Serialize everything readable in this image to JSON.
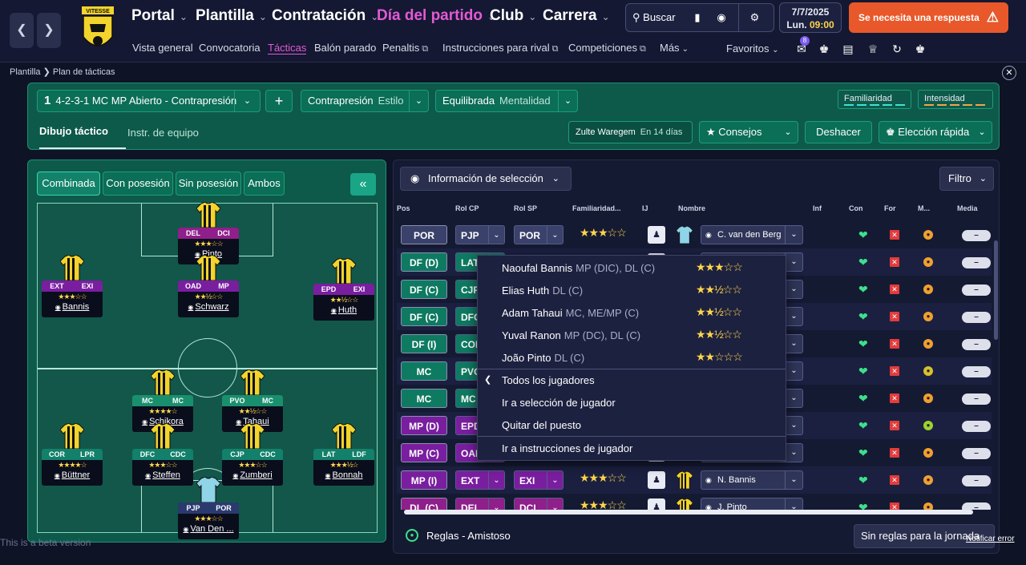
{
  "nav": {
    "items": [
      {
        "label": "Portal",
        "color": "#ffffff"
      },
      {
        "label": "Plantilla",
        "color": "#ffffff"
      },
      {
        "label": "Contratación",
        "color": "#ffffff"
      },
      {
        "label": "Día del partido",
        "color": "#e35ad4"
      },
      {
        "label": "Club",
        "color": "#ffffff"
      },
      {
        "label": "Carrera",
        "color": "#ffffff"
      }
    ],
    "sub": [
      "Vista general",
      "Convocatoria",
      "Tácticas",
      "Balón parado",
      "Penaltis",
      "Instrucciones para rival",
      "Competiciones",
      "Más"
    ],
    "active_sub": "Tácticas",
    "search_label": "Buscar",
    "date": "7/7/2025",
    "day": "Lun.",
    "time": "09:00",
    "alert": "Se necesita una respuesta",
    "favoritos": "Favoritos",
    "badge": "8",
    "crest_text": "VITESSE"
  },
  "breadcrumb": {
    "parent": "Plantilla",
    "current": "Plan de tácticas"
  },
  "tactic": {
    "number": "1",
    "name": "4-2-3-1 MC MP Abierto - Contrapresión",
    "style_value": "Contrapresión",
    "style_label": "Estilo",
    "mentality_value": "Equilibrada",
    "mentality_label": "Mentalidad",
    "familiarity": "Familiaridad",
    "intensity": "Intensidad",
    "tab_active": "Dibujo táctico",
    "tab_other": "Instr. de equipo",
    "opponent": "Zulte Waregem",
    "opponent_when": "En 14 días",
    "advice": "Consejos",
    "undo": "Deshacer",
    "quick": "Elección rápida"
  },
  "pitch_tabs": [
    "Combinada",
    "Con posesión",
    "Sin posesión",
    "Ambos"
  ],
  "players_on_pitch": [
    {
      "roles": [
        "DEL",
        "DCI"
      ],
      "stars": "★★★☆☆",
      "name": "Pinto",
      "c1": "#8f1f8a",
      "c2": "#8f1f8a"
    },
    {
      "roles": [
        "EXT",
        "EXI"
      ],
      "stars": "★★★☆☆",
      "name": "Bannis",
      "c1": "#7a1ea0",
      "c2": "#7a1ea0"
    },
    {
      "roles": [
        "OAD",
        "MP"
      ],
      "stars": "★★½☆☆",
      "name": "Schwarz",
      "c1": "#7a1ea0",
      "c2": "#7a1ea0"
    },
    {
      "roles": [
        "EPD",
        "EXI"
      ],
      "stars": "★★½☆☆",
      "name": "Huth",
      "c1": "#7a1ea0",
      "c2": "#7a1ea0"
    },
    {
      "roles": [
        "MC",
        "MC"
      ],
      "stars": "★★★★☆",
      "name": "Schikora",
      "c1": "#1a8f6e",
      "c2": "#1a8f6e"
    },
    {
      "roles": [
        "PVO",
        "MC"
      ],
      "stars": "★★½☆☆",
      "name": "Tahaui",
      "c1": "#1a8f6e",
      "c2": "#1a8f6e"
    },
    {
      "roles": [
        "COR",
        "LPR"
      ],
      "stars": "★★★★☆",
      "name": "Büttner",
      "c1": "#12806a",
      "c2": "#12806a"
    },
    {
      "roles": [
        "DFC",
        "CDC"
      ],
      "stars": "★★★☆☆",
      "name": "Steffen",
      "c1": "#12806a",
      "c2": "#12806a"
    },
    {
      "roles": [
        "CJP",
        "CDC"
      ],
      "stars": "★★★☆☆",
      "name": "Zumberi",
      "c1": "#12806a",
      "c2": "#12806a"
    },
    {
      "roles": [
        "LAT",
        "LDF"
      ],
      "stars": "★★★½☆",
      "name": "Bonnah",
      "c1": "#12806a",
      "c2": "#12806a"
    },
    {
      "roles": [
        "PJP",
        "POR"
      ],
      "stars": "★★★☆☆",
      "name": "Van Den ...",
      "c1": "#2b3a6e",
      "c2": "#2b3a6e"
    }
  ],
  "list": {
    "selector": "Información de selección",
    "filter": "Filtro",
    "headers": [
      "Pos",
      "Rol CP",
      "Rol SP",
      "Familiaridad...",
      "IJ",
      "Nombre",
      "Inf",
      "Con",
      "For",
      "M...",
      "Media"
    ],
    "rows": [
      {
        "pos": "POR",
        "rcp": "PJP",
        "rsp": "POR",
        "fam": "★★★☆☆",
        "name": "C. van den Berg",
        "color": "#3a416a",
        "mcol": "#f0a030",
        "kit": "gk"
      },
      {
        "pos": "DF (D)",
        "rcp": "LAT",
        "rsp": "",
        "fam": "",
        "name": "",
        "color": "#0e7a61",
        "mcol": "#f0a030",
        "kit": ""
      },
      {
        "pos": "DF (C)",
        "rcp": "CJP",
        "rsp": "",
        "fam": "",
        "name": "",
        "color": "#0e7a61",
        "mcol": "#f0a030",
        "kit": ""
      },
      {
        "pos": "DF (C)",
        "rcp": "DFC",
        "rsp": "",
        "fam": "",
        "name": "",
        "color": "#0e7a61",
        "mcol": "#f0a030",
        "kit": ""
      },
      {
        "pos": "DF (I)",
        "rcp": "COR",
        "rsp": "",
        "fam": "",
        "name": "",
        "color": "#0e7a61",
        "mcol": "#f0a030",
        "kit": ""
      },
      {
        "pos": "MC",
        "rcp": "PVO",
        "rsp": "",
        "fam": "",
        "name": "",
        "color": "#0e7a61",
        "mcol": "#d8c030",
        "kit": ""
      },
      {
        "pos": "MC",
        "rcp": "MC",
        "rsp": "",
        "fam": "",
        "name": "",
        "color": "#0e7a61",
        "mcol": "#f0a030",
        "kit": ""
      },
      {
        "pos": "MP (D)",
        "rcp": "EPD",
        "rsp": "",
        "fam": "",
        "name": "",
        "color": "#7a1ea0",
        "mcol": "#9fd030",
        "kit": ""
      },
      {
        "pos": "MP (C)",
        "rcp": "OAD",
        "rsp": "",
        "fam": "",
        "name": "",
        "color": "#7a1ea0",
        "mcol": "#f0a030",
        "kit": ""
      },
      {
        "pos": "MP (I)",
        "rcp": "EXT",
        "rsp": "EXI",
        "fam": "★★★☆☆",
        "name": "N. Bannis",
        "color": "#7a1ea0",
        "mcol": "#f0a030",
        "kit": "field"
      },
      {
        "pos": "DL (C)",
        "rcp": "DEL",
        "rsp": "DCI",
        "fam": "★★★☆☆",
        "name": "J. Pinto",
        "color": "#8f1f8a",
        "mcol": "#f0a030",
        "kit": "field"
      }
    ]
  },
  "popup": {
    "candidates": [
      {
        "name": "Naoufal Bannis",
        "pos": "MP (DIC), DL (C)",
        "stars": "★★★☆☆"
      },
      {
        "name": "Elias Huth",
        "pos": "DL (C)",
        "stars": "★★½☆☆"
      },
      {
        "name": "Adam Tahaui",
        "pos": "MC, ME/MP (C)",
        "stars": "★★½☆☆"
      },
      {
        "name": "Yuval Ranon",
        "pos": "MP (DC), DL (C)",
        "stars": "★★½☆☆"
      },
      {
        "name": "João Pinto",
        "pos": "DL (C)",
        "stars": "★★☆☆☆"
      }
    ],
    "all_players": "Todos los jugadores",
    "go_selection": "Ir a selección de jugador",
    "remove": "Quitar del puesto",
    "go_instructions": "Ir a instrucciones de jugador"
  },
  "footer": {
    "rules": "Reglas - Amistoso",
    "no_rules": "Sin reglas para la jornada",
    "beta": "This is a beta version",
    "notify": "Notificar error"
  }
}
